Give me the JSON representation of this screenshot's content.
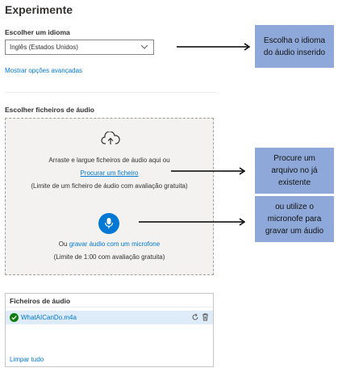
{
  "page": {
    "title": "Experimente"
  },
  "language": {
    "label": "Escolher um idioma",
    "selected": "Inglês (Estados Unidos)",
    "advanced_link": "Mostrar opções avançadas"
  },
  "audio_upload": {
    "label": "Escolher ficheiros de áudio",
    "drag_text": "Arraste e largue ficheiros de áudio aqui ou",
    "browse_link": "Procurar um ficheiro",
    "file_limit": "(Limite de um ficheiro de áudio com avaliação gratuita)",
    "record_prefix": "Ou",
    "record_link": "gravar áudio com um microfone",
    "record_limit": "(Limite de 1:00 com avaliação gratuita)"
  },
  "files": {
    "header": "Ficheiros de áudio",
    "items": [
      {
        "name": "WhatAICanDo.m4a"
      }
    ],
    "clear_all": "Limpar tudo"
  },
  "annotations": {
    "language_note_line1": "Escolha o idioma",
    "language_note_line2": "do áudio inserido",
    "browse_note_line1": "Procure um",
    "browse_note_line2": "arquivo no já",
    "browse_note_line3": "existente",
    "mic_note_line1": "ou utilize o",
    "mic_note_line2": "micronofe para",
    "mic_note_line3": "gravar um áudio"
  },
  "colors": {
    "accent": "#0078d4",
    "success": "#107c10",
    "dropzone_bg": "#f3f2f1",
    "note_bg": "#8ea9d9",
    "selected_row": "#deecf9"
  },
  "icons": [
    "chevron-down-icon",
    "cloud-upload-icon",
    "microphone-icon",
    "check-circle-icon",
    "refresh-icon",
    "trash-icon",
    "arrow-right-icon"
  ]
}
